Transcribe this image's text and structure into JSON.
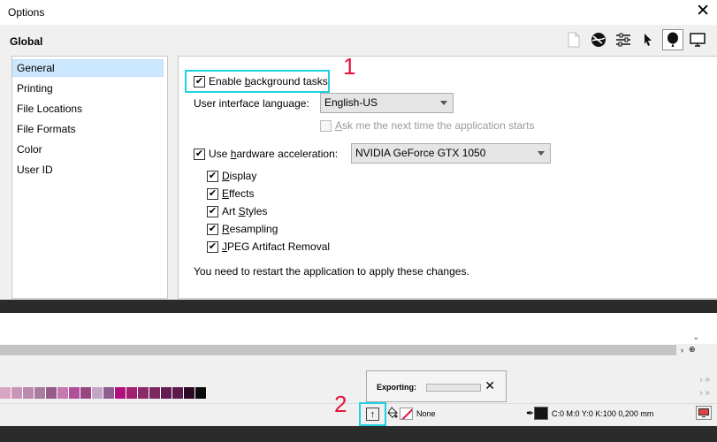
{
  "dialog": {
    "title": "Options",
    "close_glyph": "✕",
    "section_title": "Global",
    "toolbar_icons": [
      "page-icon",
      "globe-icon",
      "sliders-icon",
      "pointer-icon",
      "balloon-icon",
      "monitor-icon"
    ],
    "toolbar_selected": "balloon-icon"
  },
  "nav": {
    "items": [
      {
        "label": "General",
        "selected": true
      },
      {
        "label": "Printing"
      },
      {
        "label": "File Locations"
      },
      {
        "label": "File Formats"
      },
      {
        "label": "Color"
      },
      {
        "label": "User ID"
      }
    ]
  },
  "general": {
    "background_tasks": {
      "pre": "Enable ",
      "u": "b",
      "post": "ackground tasks",
      "checked": true
    },
    "ui_language": {
      "label": "User interface language:",
      "value": "English-US"
    },
    "ask_next_time": {
      "pre": "",
      "u": "A",
      "post": "sk me the next time the application starts",
      "checked": false,
      "disabled": true
    },
    "hw_accel": {
      "pre": "Use ",
      "u": "h",
      "post": "ardware acceleration:",
      "checked": true,
      "value": "NVIDIA GeForce GTX 1050"
    },
    "sub_options": [
      {
        "pre": "",
        "u": "D",
        "post": "isplay",
        "checked": true
      },
      {
        "pre": "",
        "u": "E",
        "post": "ffects",
        "checked": true
      },
      {
        "pre": "Art ",
        "u": "S",
        "post": "tyles",
        "checked": true
      },
      {
        "pre": "",
        "u": "R",
        "post": "esampling",
        "checked": true
      },
      {
        "pre": "",
        "u": "J",
        "post": "PEG Artifact Removal",
        "checked": true
      }
    ],
    "restart_notice": "You need to restart the application to apply these changes."
  },
  "callouts": {
    "one": "1",
    "two": "2"
  },
  "export_popup": {
    "title": "Exporting:",
    "progress": 0,
    "close_glyph": "✕"
  },
  "statusbar": {
    "fill_label": "None",
    "outline_text": "C:0 M:0 Y:0 K:100  0,200 mm"
  },
  "colors": {
    "highlight": "#1ed2e0",
    "callout": "#e8143c",
    "selection": "#cce8ff",
    "palette": [
      "#d8a6c4",
      "#c994b6",
      "#b98aad",
      "#a77c9f",
      "#955c88",
      "#c678b0",
      "#b0509a",
      "#97467f",
      "#c2a4c4",
      "#8f5d8f",
      "#b3107f",
      "#a21f72",
      "#8a2a6a",
      "#7b2a5f",
      "#651c54",
      "#5c1b4c",
      "#2c0a26",
      "#0a0a0a"
    ]
  }
}
